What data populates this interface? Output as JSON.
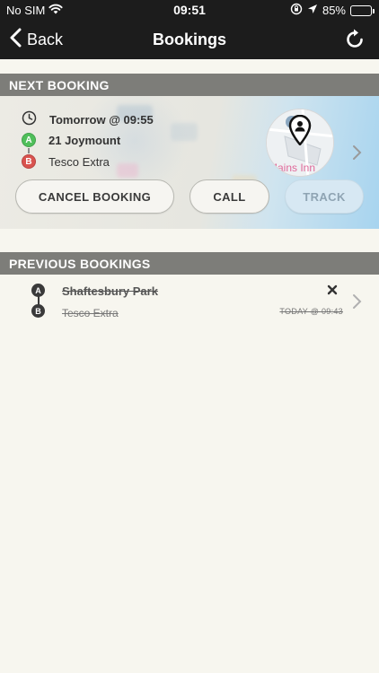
{
  "status_bar": {
    "carrier": "No SIM",
    "time": "09:51",
    "battery": "85%",
    "battery_level": 0.85,
    "battery_color": "#f2c200"
  },
  "nav": {
    "back_label": "Back",
    "title": "Bookings",
    "refresh_icon": "refresh-icon"
  },
  "next_booking": {
    "header": "NEXT BOOKING",
    "when": "Tomorrow @ 09:55",
    "pickup": "21 Joymount",
    "dropoff": "Tesco Extra",
    "pickup_marker": "A",
    "dropoff_marker": "B",
    "map_text": "Mains Inn",
    "map_text_partial": "s",
    "buttons": {
      "cancel": "CANCEL BOOKING",
      "call": "CALL",
      "track": "TRACK"
    }
  },
  "previous_bookings": {
    "header": "PREVIOUS BOOKINGS",
    "items": [
      {
        "pickup": "Shaftesbury Park",
        "dropoff": "Tesco Extra",
        "time": "TODAY @ 09:43",
        "pickup_marker": "A",
        "dropoff_marker": "B",
        "status_icon": "cancelled-x-icon"
      }
    ]
  },
  "colors": {
    "bar_bg": "#1c1c1c",
    "section_header_bg": "#7d7d79",
    "page_bg": "#f7f6ef",
    "marker_a": "#4fbf5a",
    "marker_b": "#d9534f",
    "track_disabled_bg": "#d7e8f3"
  }
}
